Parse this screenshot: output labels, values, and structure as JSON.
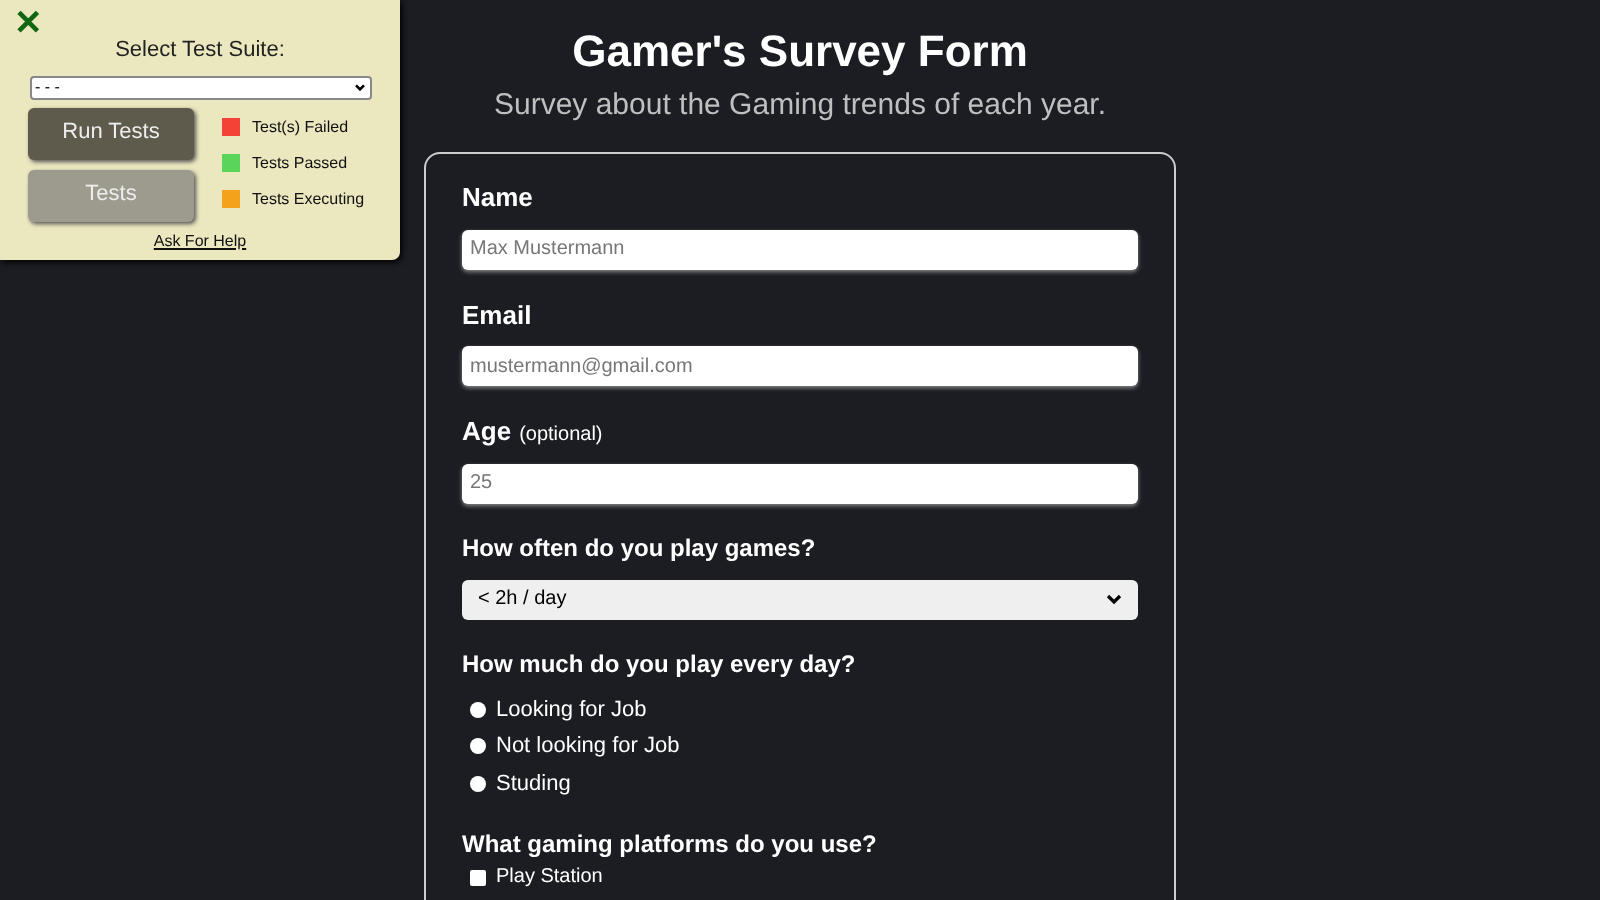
{
  "header": {
    "title": "Gamer's Survey Form",
    "subtitle": "Survey about the Gaming trends of each year."
  },
  "form": {
    "name": {
      "label": "Name",
      "placeholder": "Max Mustermann"
    },
    "email": {
      "label": "Email",
      "placeholder": "mustermann@gmail.com"
    },
    "age": {
      "label": "Age",
      "note": "(optional)",
      "placeholder": "25"
    },
    "frequency": {
      "label": "How often do you play games?",
      "value": "< 2h / day"
    },
    "daily": {
      "label": "How much do you play every day?",
      "options": [
        {
          "label": "Looking for Job",
          "selected": false
        },
        {
          "label": "Not looking for Job",
          "selected": false
        },
        {
          "label": "Studing",
          "selected": false
        }
      ]
    },
    "platforms": {
      "label": "What gaming platforms do you use?",
      "options": [
        {
          "label": "Play Station",
          "checked": false
        }
      ]
    }
  },
  "test_panel": {
    "close": "✕",
    "title": "Select Test Suite:",
    "suite": "- - -",
    "buttons": [
      "Run Tests",
      "Tests"
    ],
    "legend": [
      {
        "label": "Test(s) Failed",
        "color": "#f44336"
      },
      {
        "label": "Tests Passed",
        "color": "#5ad55a"
      },
      {
        "label": "Tests Executing",
        "color": "#f4a21b"
      }
    ],
    "help": "Ask For Help"
  }
}
